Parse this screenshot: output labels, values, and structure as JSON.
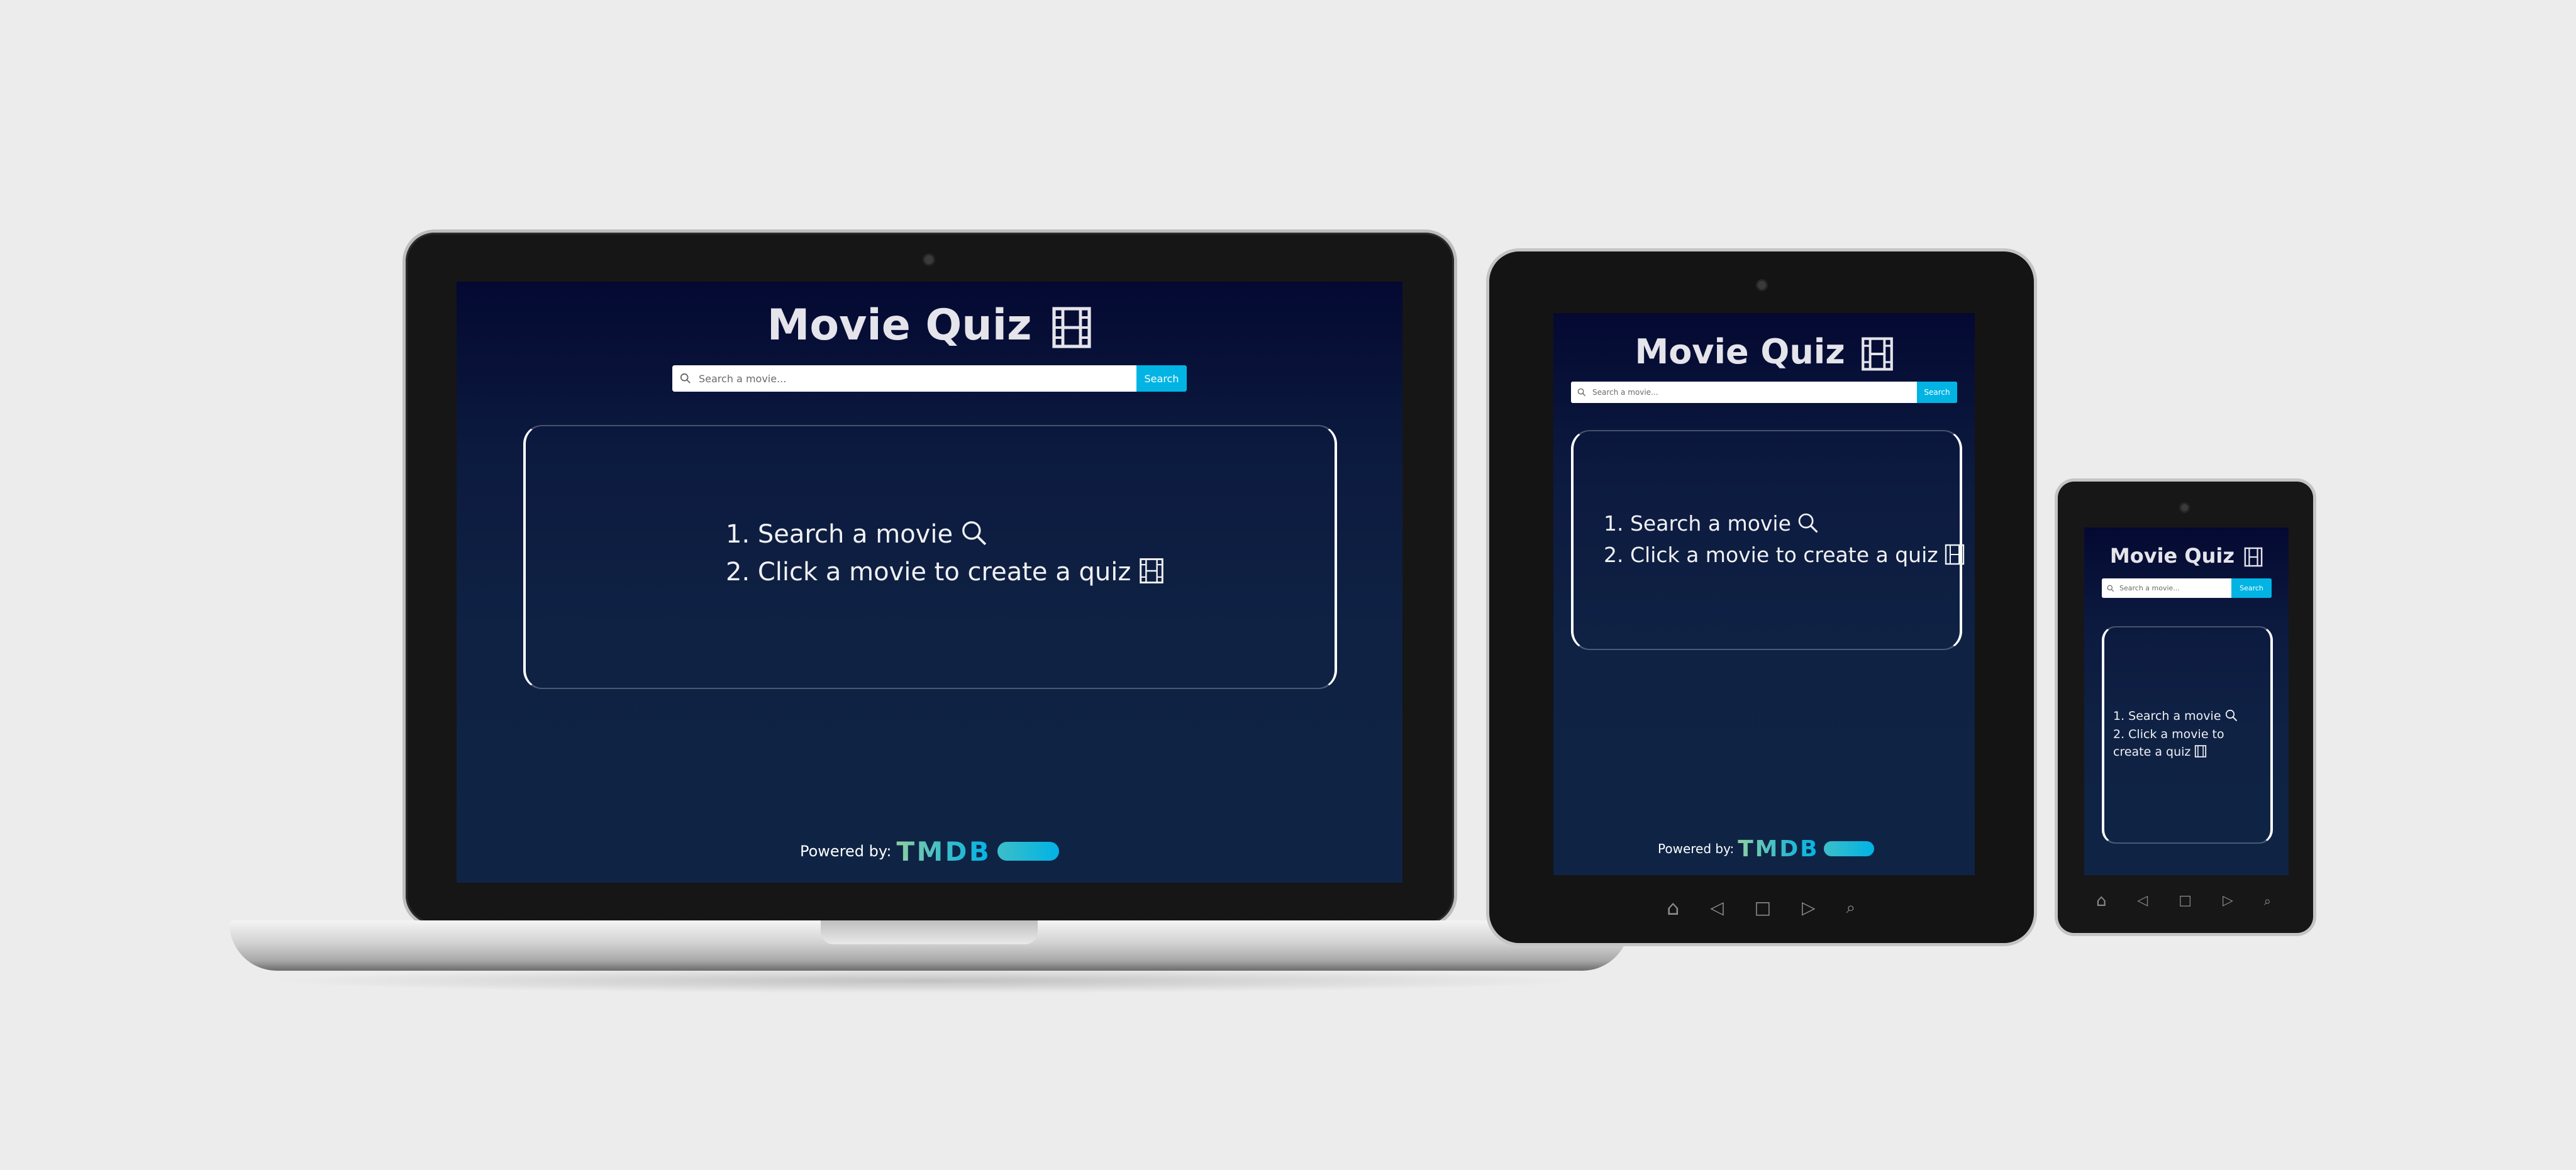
{
  "app": {
    "title": "Movie Quiz",
    "title_icon": "film-icon",
    "search": {
      "placeholder": "Search a movie...",
      "button_label": "Search",
      "icon": "search-icon"
    },
    "instructions": {
      "step_1": "1. Search a movie",
      "step_1_icon": "search-icon",
      "step_2": "2. Click a movie to create a quiz",
      "step_2_icon": "film-icon"
    },
    "footer": {
      "powered_label": "Powered by:",
      "provider_logo_text": "TMDB"
    }
  },
  "devices": [
    "laptop",
    "tablet",
    "phone"
  ],
  "nav_bar_icons": [
    "home-icon",
    "back-icon",
    "recent-apps-icon",
    "forward-icon",
    "search-icon"
  ],
  "colors": {
    "page_background": "#ececec",
    "screen_gradient_top": "#040932",
    "screen_gradient_bottom": "#0f2445",
    "search_button": "#01b4e4",
    "tmdb_gradient_start": "#90cea1",
    "tmdb_gradient_end": "#01b4e4",
    "device_frame": "#161616"
  }
}
